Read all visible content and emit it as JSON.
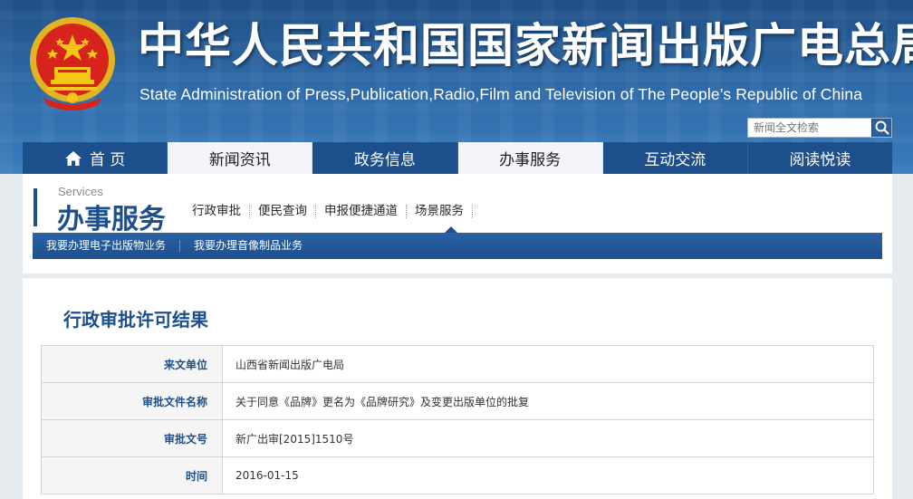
{
  "header": {
    "title": "中华人民共和国国家新闻出版广电总局",
    "subtitle": "State Administration of Press,Publication,Radio,Film and Television of The People’s Republic of China",
    "search_placeholder": "新闻全文检索",
    "emblem_icon": "national-emblem-icon",
    "search_icon": "search-icon"
  },
  "nav": {
    "items": [
      {
        "label": "首 页",
        "icon": "home-icon",
        "active": false
      },
      {
        "label": "新闻资讯",
        "active": false
      },
      {
        "label": "政务信息",
        "active": false
      },
      {
        "label": "办事服务",
        "active": true
      },
      {
        "label": "互动交流",
        "active": false
      },
      {
        "label": "阅读悦读",
        "active": false
      }
    ]
  },
  "section": {
    "en": "Services",
    "cn": "办事服务",
    "tabs": [
      "行政审批",
      "便民查询",
      "申报便捷通道",
      "场景服务"
    ],
    "sublinks": [
      "我要办理电子出版物业务",
      "我要办理音像制品业务"
    ]
  },
  "detail": {
    "title": "行政审批许可结果",
    "rows": [
      {
        "label": "来文单位",
        "value": "山西省新闻出版广电局"
      },
      {
        "label": "审批文件名称",
        "value": "关于同意《品牌》更名为《品牌研究》及变更出版单位的批复"
      },
      {
        "label": "审批文号",
        "value": "新广出审[2015]1510号"
      },
      {
        "label": "时间",
        "value": "2016-01-15"
      }
    ]
  },
  "colors": {
    "primary": "#1c4f8b",
    "banner": "#2d68a6",
    "emblem_red": "#d6231c",
    "emblem_gold": "#f5c518"
  }
}
